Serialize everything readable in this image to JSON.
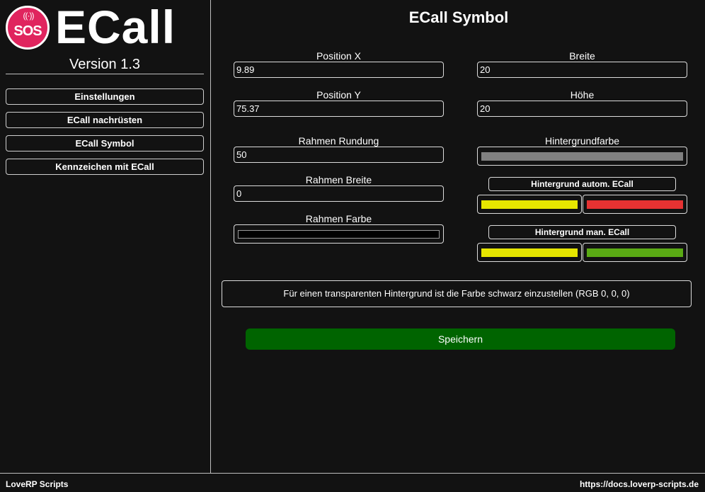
{
  "sidebar": {
    "logo_badge": "SOS",
    "logo_text": "ECall",
    "version": "Version 1.3",
    "nav": [
      {
        "label": "Einstellungen"
      },
      {
        "label": "ECall nachrüsten"
      },
      {
        "label": "ECall Symbol"
      },
      {
        "label": "Kennzeichen mit ECall"
      }
    ]
  },
  "main": {
    "title": "ECall Symbol",
    "fields": {
      "pos_x": {
        "label": "Position X",
        "value": "9.89"
      },
      "pos_y": {
        "label": "Position Y",
        "value": "75.37"
      },
      "breite": {
        "label": "Breite",
        "value": "20"
      },
      "hoehe": {
        "label": "Höhe",
        "value": "20"
      },
      "rahmen_rundung": {
        "label": "Rahmen Rundung",
        "value": "50"
      },
      "rahmen_breite": {
        "label": "Rahmen Breite",
        "value": "0"
      },
      "rahmen_farbe": {
        "label": "Rahmen Farbe",
        "color": "#000000"
      },
      "hintergrundfarbe": {
        "label": "Hintergrundfarbe",
        "color": "#808080"
      }
    },
    "auto_ecall": {
      "label": "Hintergrund autom. ECall",
      "color1": "#e6e600",
      "color2": "#e63232"
    },
    "man_ecall": {
      "label": "Hintergrund man. ECall",
      "color1": "#e6e600",
      "color2": "#5aaa14"
    },
    "note": "Für einen transparenten Hintergrund ist die Farbe schwarz einzustellen (RGB 0, 0, 0)",
    "save_label": "Speichern"
  },
  "footer": {
    "left": "LoveRP Scripts",
    "right": "https://docs.loverp-scripts.de"
  }
}
